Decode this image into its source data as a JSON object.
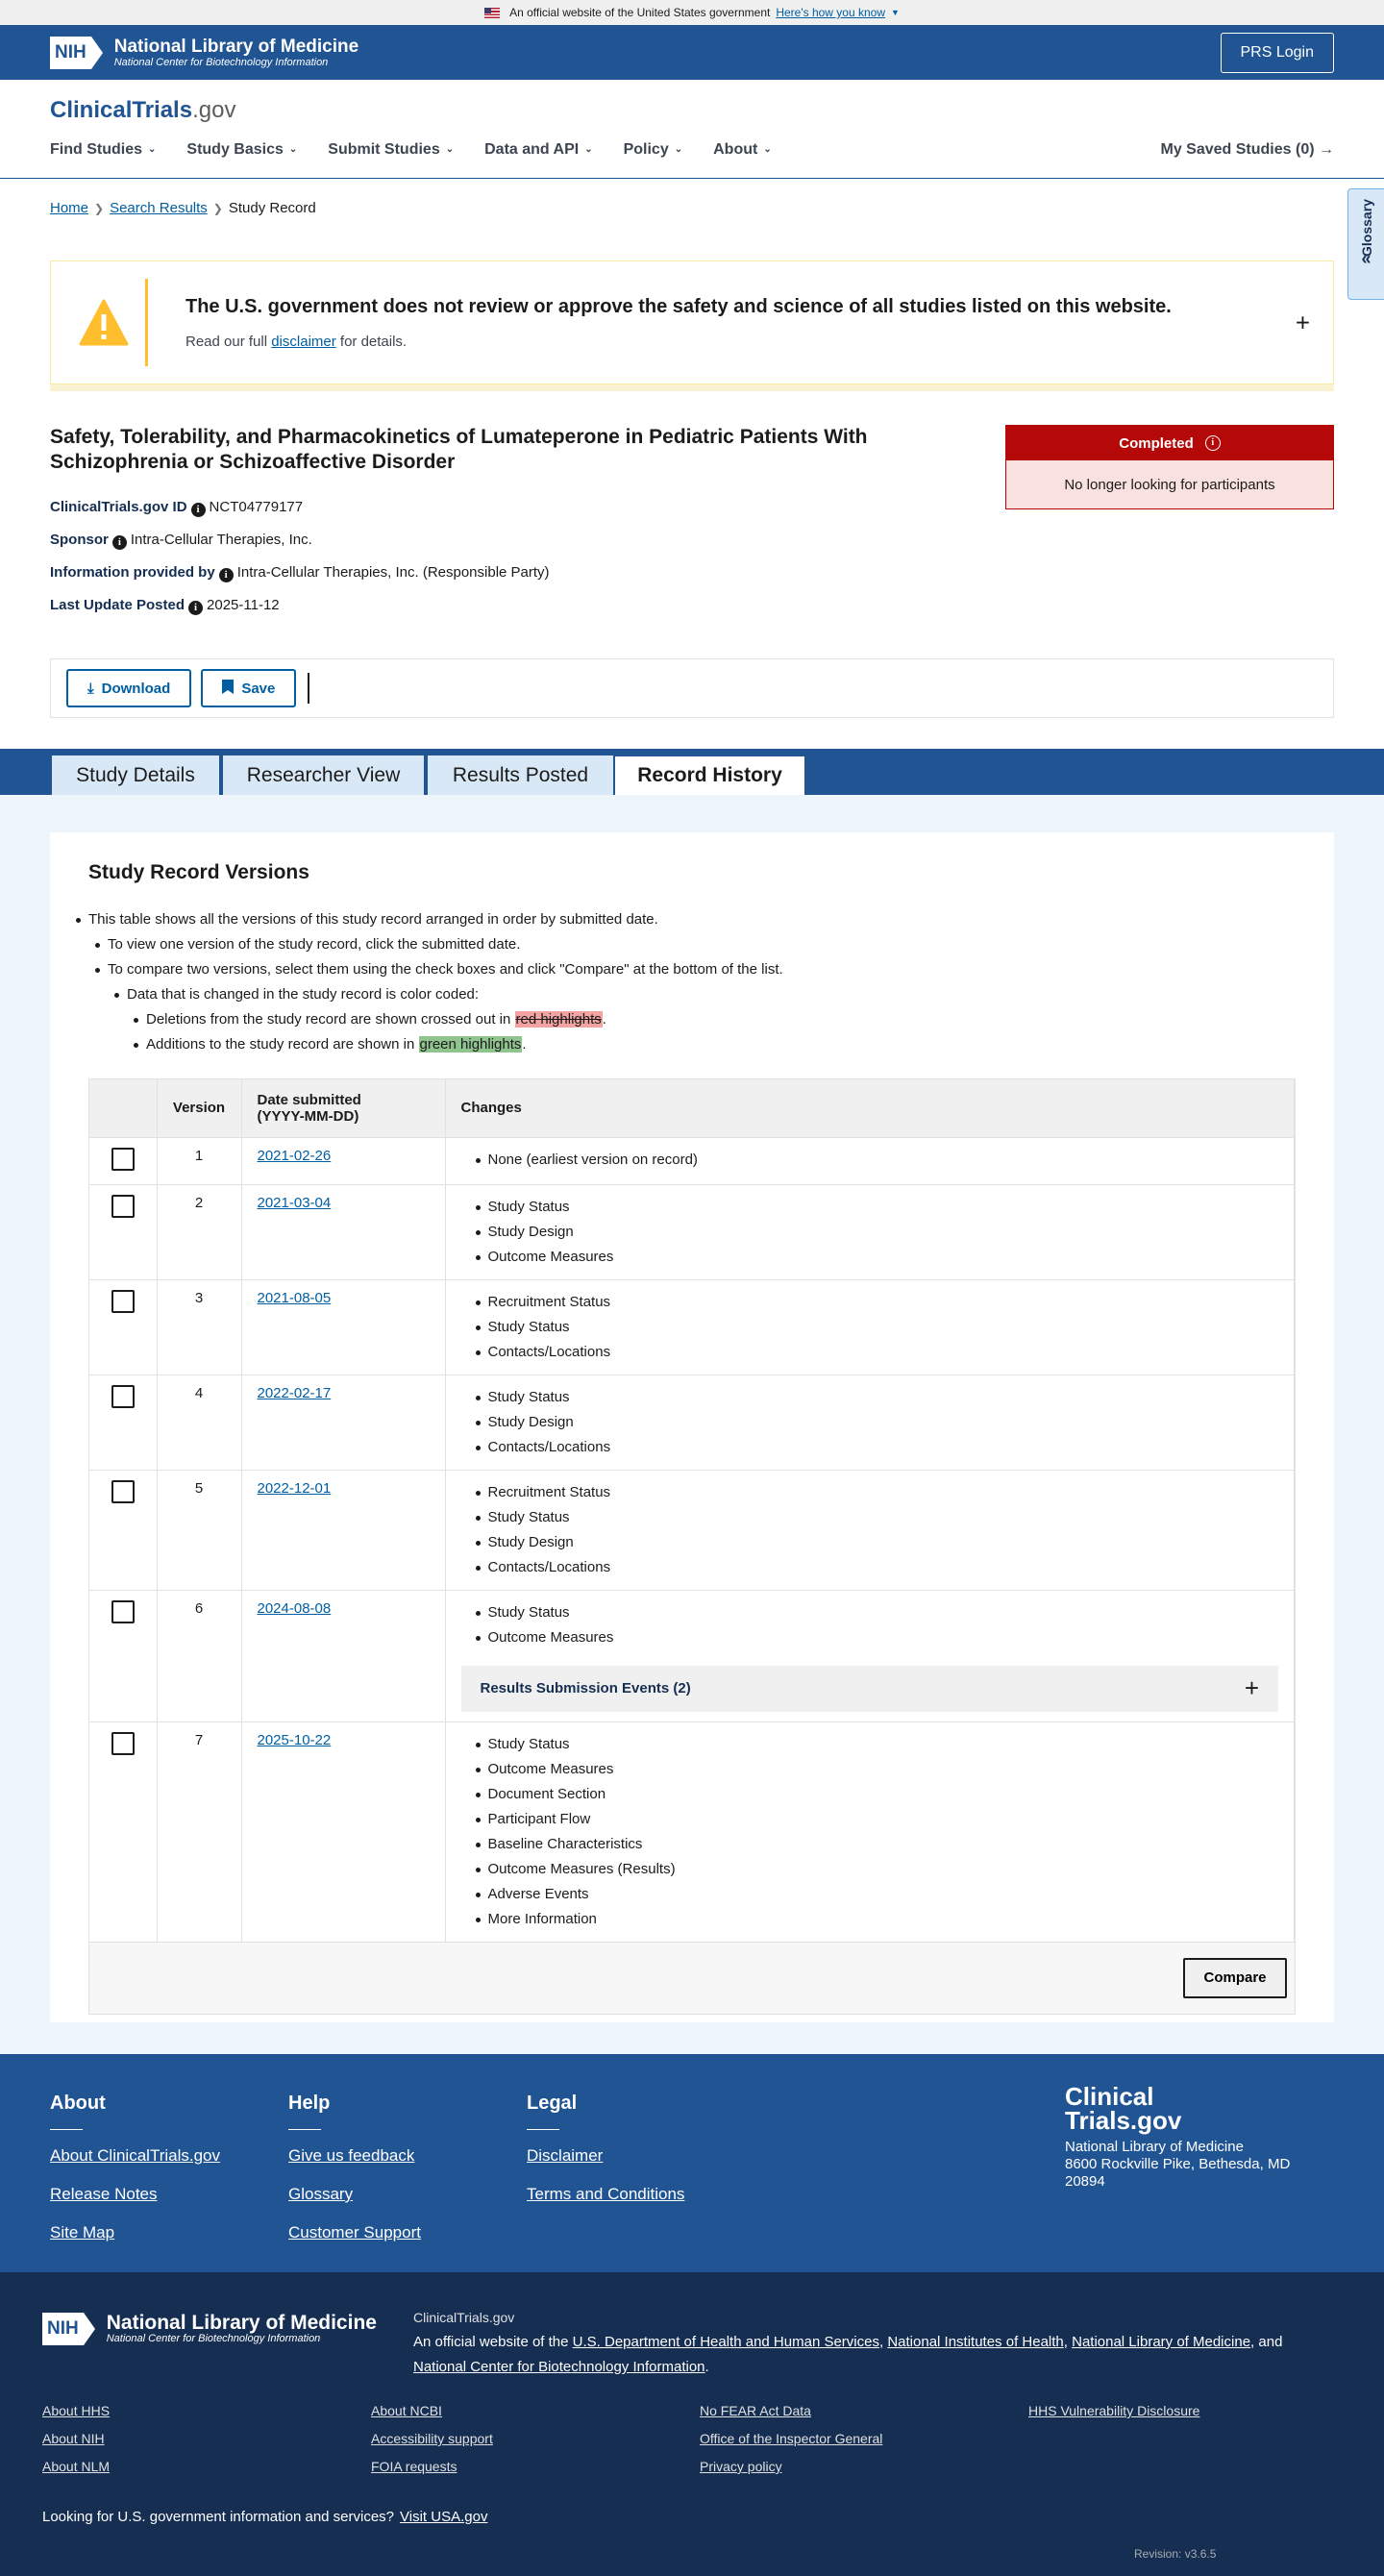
{
  "gov_banner": {
    "text": "An official website of the United States government",
    "link": "Here's how you know"
  },
  "nih_header": {
    "name": "National Library of Medicine",
    "subname": "National Center for Biotechnology Information",
    "logo": "NIH",
    "login": "PRS Login"
  },
  "site": {
    "logo_main": "ClinicalTrials",
    "logo_gov": ".gov"
  },
  "nav": {
    "items": [
      "Find Studies",
      "Study Basics",
      "Submit Studies",
      "Data and API",
      "Policy",
      "About"
    ],
    "saved": "My Saved Studies (0)"
  },
  "breadcrumb": {
    "home": "Home",
    "search": "Search Results",
    "current": "Study Record"
  },
  "glossary": {
    "label": "Glossary"
  },
  "alert": {
    "heading": "The U.S. government does not review or approve the safety and science of all studies listed on this website.",
    "pre": "Read our full ",
    "link": "disclaimer",
    "post": " for details."
  },
  "study": {
    "title": "Safety, Tolerability, and Pharmacokinetics of Lumateperone in Pediatric Patients With Schizophrenia or Schizoaffective Disorder",
    "id_label": "ClinicalTrials.gov ID",
    "id": "NCT04779177",
    "sponsor_label": "Sponsor",
    "sponsor": "Intra-Cellular Therapies, Inc.",
    "info_label": "Information provided by",
    "info": "Intra-Cellular Therapies, Inc. (Responsible Party)",
    "update_label": "Last Update Posted",
    "update": "2025-11-12",
    "status": "Completed",
    "status_detail": "No longer looking for participants"
  },
  "actions": {
    "download": "Download",
    "save": "Save"
  },
  "tabs": [
    "Study Details",
    "Researcher View",
    "Results Posted",
    "Record History"
  ],
  "versions": {
    "heading": "Study Record Versions",
    "instructions": {
      "l1": "This table shows all the versions of this study record arranged in order by submitted date.",
      "l2": "To view one version of the study record, click the submitted date.",
      "l3": "To compare two versions, select them using the check boxes and click \"Compare\" at the bottom of the list.",
      "l4": "Data that is changed in the study record is color coded:",
      "l5_pre": "Deletions from the study record are shown crossed out in ",
      "l5_mark": "red highlights",
      "l5_post": ".",
      "l6_pre": "Additions to the study record are shown in ",
      "l6_mark": "green highlights",
      "l6_post": "."
    },
    "col_version": "Version",
    "col_date_l1": "Date submitted",
    "col_date_l2": "(YYYY-MM-DD)",
    "col_changes": "Changes",
    "rows": [
      {
        "version": "1",
        "date": "2021-02-26",
        "changes": [
          "None (earliest version on record)"
        ]
      },
      {
        "version": "2",
        "date": "2021-03-04",
        "changes": [
          "Study Status",
          "Study Design",
          "Outcome Measures"
        ]
      },
      {
        "version": "3",
        "date": "2021-08-05",
        "changes": [
          "Recruitment Status",
          "Study Status",
          "Contacts/Locations"
        ]
      },
      {
        "version": "4",
        "date": "2022-02-17",
        "changes": [
          "Study Status",
          "Study Design",
          "Contacts/Locations"
        ]
      },
      {
        "version": "5",
        "date": "2022-12-01",
        "changes": [
          "Recruitment Status",
          "Study Status",
          "Study Design",
          "Contacts/Locations"
        ]
      },
      {
        "version": "6",
        "date": "2024-08-08",
        "changes": [
          "Study Status",
          "Outcome Measures"
        ],
        "events": "Results Submission Events (2)"
      },
      {
        "version": "7",
        "date": "2025-10-22",
        "changes": [
          "Study Status",
          "Outcome Measures",
          "Document Section",
          "Participant Flow",
          "Baseline Characteristics",
          "Outcome Measures (Results)",
          "Adverse Events",
          "More Information"
        ]
      }
    ],
    "compare": "Compare"
  },
  "footer": {
    "about": {
      "title": "About",
      "links": [
        "About ClinicalTrials.gov",
        "Release Notes",
        "Site Map"
      ]
    },
    "help": {
      "title": "Help",
      "links": [
        "Give us feedback",
        "Glossary",
        "Customer Support"
      ]
    },
    "legal": {
      "title": "Legal",
      "links": [
        "Disclaimer",
        "Terms and Conditions"
      ]
    },
    "brand_l1": "Clinical",
    "brand_l2": "Trials.gov",
    "address_l1": "National Library of Medicine",
    "address_l2": "8600 Rockville Pike, Bethesda, MD 20894"
  },
  "footer2": {
    "site": "ClinicalTrials.gov",
    "official_pre": "An official website of the ",
    "hhs": "U.S. Department of Health and Human Services",
    "nih": "National Institutes of Health",
    "nlm": "National Library of Medicine",
    "and": ", and ",
    "ncbi": "National Center for Biotechnology Information",
    "col1": [
      "About HHS",
      "About NIH",
      "About NLM"
    ],
    "col2": [
      "About NCBI",
      "Accessibility support",
      "FOIA requests"
    ],
    "col3": [
      "No FEAR Act Data",
      "Office of the Inspector General",
      "Privacy policy"
    ],
    "col4": [
      "HHS Vulnerability Disclosure"
    ],
    "usa_pre": "Looking for U.S. government information and services?",
    "usa_link": "Visit USA.gov",
    "revision": "Revision: v3.6.5"
  }
}
